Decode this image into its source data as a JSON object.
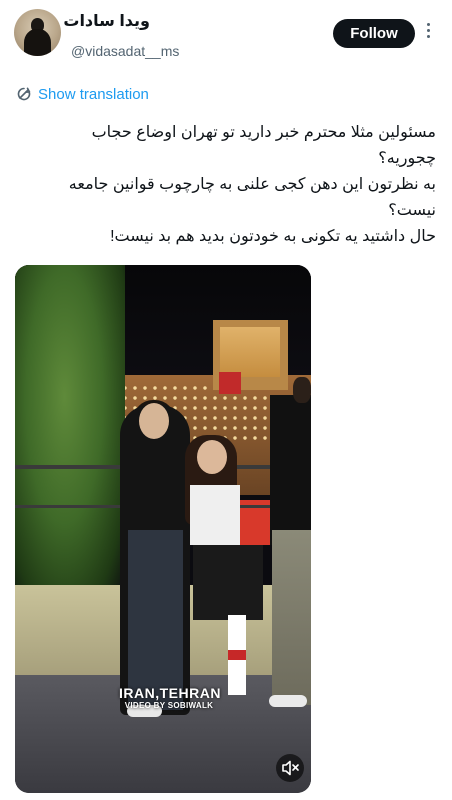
{
  "header": {
    "display_name": "ویدا سادات",
    "handle": "@vidasadat__ms",
    "follow_label": "Follow"
  },
  "translate": {
    "label": "Show translation",
    "icon": "translate-icon"
  },
  "tweet": {
    "lines": [
      "مسئولین مثلا محترم خبر دارید تو تهران اوضاع حجاب",
      "چجوریه؟",
      "به نظرتون این دهن کجی علنی به چارچوب قوانین جامعه",
      "نیست؟",
      "حال داشتید یه تکونی به خودتون بدید هم بد نیست!"
    ]
  },
  "media": {
    "watermark_city": "IRAN,TEHRAN",
    "watermark_credit": "VIDEO BY SOBIWALK",
    "mute_icon": "speaker-muted-icon"
  },
  "colors": {
    "accent": "#1d9bf0",
    "text": "#0f1419",
    "secondary": "#536471",
    "button": "#0f1419"
  }
}
